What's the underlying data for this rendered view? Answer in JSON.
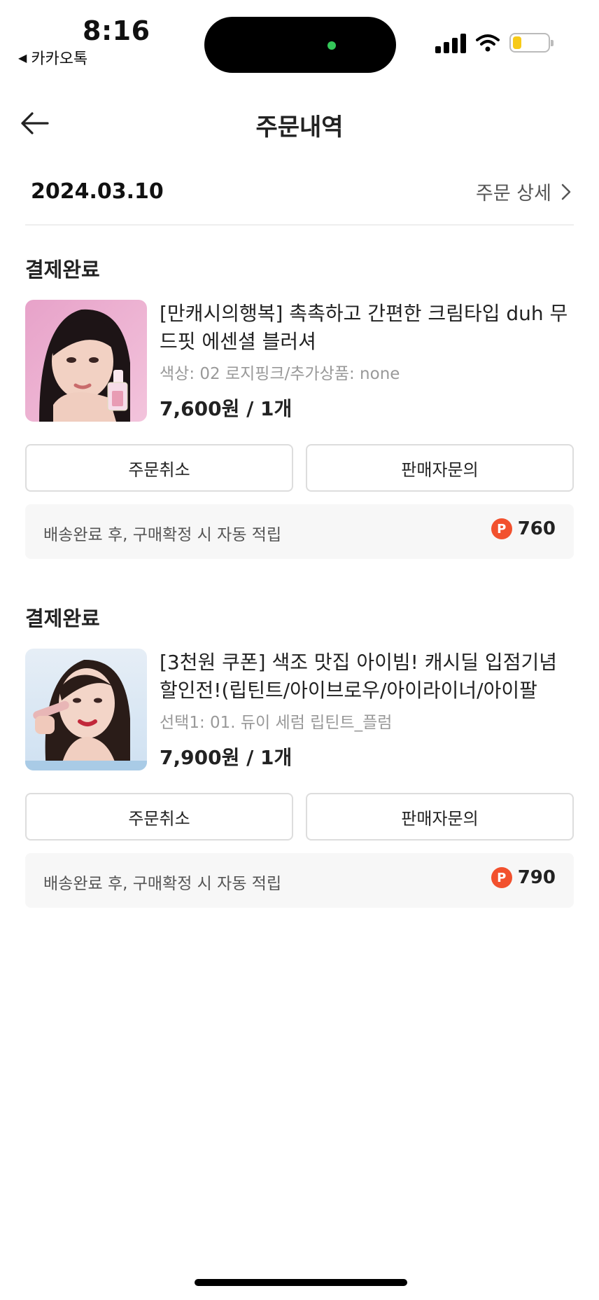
{
  "status_bar": {
    "time": "8:16",
    "back_app": "카카오톡",
    "back_app_icon": "triangle-left-icon",
    "island_dot_color": "#34c759",
    "battery_level": 0.25,
    "battery_color": "#f7ca18"
  },
  "header": {
    "title": "주문내역",
    "back_icon": "arrow-left-icon"
  },
  "order_group": {
    "date": "2024.03.10",
    "detail_link": "주문 상세",
    "detail_icon": "chevron-right-icon"
  },
  "orders": [
    {
      "status": "결제완료",
      "title": "[만캐시의행복] 촉촉하고 간편한 크림타입 duh 무드핏 에센셜 블러셔",
      "option": "색상: 02 로지핑크/추가상품: none",
      "price": "7,600원 / 1개",
      "cancel_label": "주문취소",
      "inquiry_label": "판매자문의",
      "reward_text": "배송완료 후, 구매확정 시 자동 적립",
      "reward_badge": "P",
      "reward_points": "760"
    },
    {
      "status": "결제완료",
      "title": "[3천원 쿠폰] 색조 맛집 아이빔! 캐시딜 입점기념 할인전!(립틴트/아이브로우/아이라이너/아이팔",
      "option": "선택1: 01. 듀이 세럼 립틴트_플럼",
      "price": "7,900원 / 1개",
      "cancel_label": "주문취소",
      "inquiry_label": "판매자문의",
      "reward_text": "배송완료 후, 구매확정 시 자동 적립",
      "reward_badge": "P",
      "reward_points": "790"
    }
  ],
  "colors": {
    "accent_point": "#f2512e",
    "reward_bg": "#f7f7f7"
  }
}
